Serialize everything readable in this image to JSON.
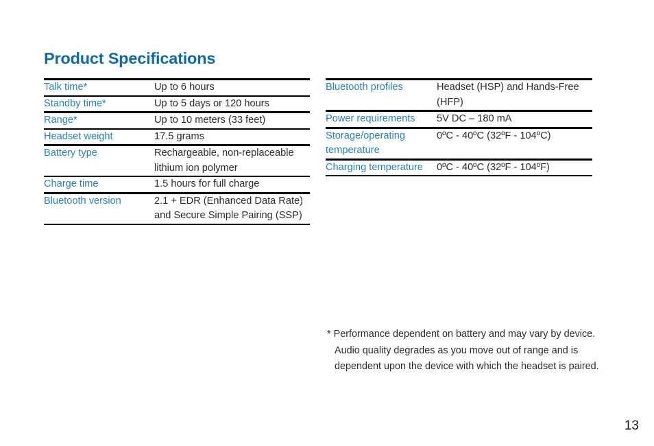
{
  "document": {
    "title": "Product Specifications",
    "page_number": "13",
    "accent_color": "#0d6aad",
    "label_color": "#2480c4",
    "value_color": "#2b2b2b",
    "rule_color": "#000000"
  },
  "left_table": {
    "rows": [
      {
        "label": "Talk time*",
        "value": "Up to 6 hours"
      },
      {
        "label": "Standby time*",
        "value": "Up to 5 days or 120 hours"
      },
      {
        "label": "Range*",
        "value": "Up to 10 meters (33 feet)"
      },
      {
        "label": "Headset weight",
        "value": "17.5 grams"
      },
      {
        "label": "Battery type",
        "value": "Rechargeable, non-replaceable lithium ion polymer"
      },
      {
        "label": "Charge time",
        "value": "1.5 hours for full charge"
      },
      {
        "label": "Bluetooth version",
        "value": "2.1 + EDR (Enhanced Data Rate) and Secure Simple Pairing (SSP)"
      }
    ]
  },
  "right_table": {
    "rows": [
      {
        "label": "Bluetooth profiles",
        "value": "Headset (HSP) and Hands-Free (HFP)"
      },
      {
        "label": "Power requirements",
        "value": "5V DC – 180 mA"
      },
      {
        "label": "Storage/operating temperature",
        "value": "0ºC - 40ºC (32ºF - 104ºC)"
      },
      {
        "label": "Charging temperature",
        "value": "0ºC - 40ºC (32ºF - 104ºF)"
      }
    ]
  },
  "footnote": {
    "text": "* Performance dependent on battery and may vary by device. Audio quality degrades as you move out of range and is dependent upon the device with which the headset is paired."
  }
}
